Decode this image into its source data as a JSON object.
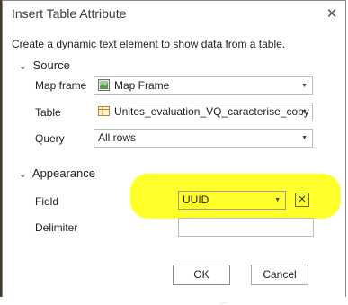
{
  "dialog": {
    "title": "Insert Table Attribute",
    "close_glyph": "✕",
    "description": "Create a dynamic text element to show data from a table."
  },
  "source": {
    "header": "Source",
    "chevron": "⌄",
    "map_frame": {
      "label": "Map frame",
      "value": "Map Frame",
      "icon": "map-frame-icon"
    },
    "table": {
      "label": "Table",
      "value": "Unites_evaluation_VQ_caracterise_copy",
      "icon": "table-icon"
    },
    "query": {
      "label": "Query",
      "value": "All rows"
    }
  },
  "appearance": {
    "header": "Appearance",
    "chevron": "⌄",
    "field": {
      "label": "Field",
      "value": "UUID",
      "clear_glyph": "✕"
    },
    "delimiter": {
      "label": "Delimiter",
      "value": ""
    }
  },
  "buttons": {
    "ok": "OK",
    "cancel": "Cancel"
  },
  "dropdown_arrow": "▼",
  "background_text": "..."
}
